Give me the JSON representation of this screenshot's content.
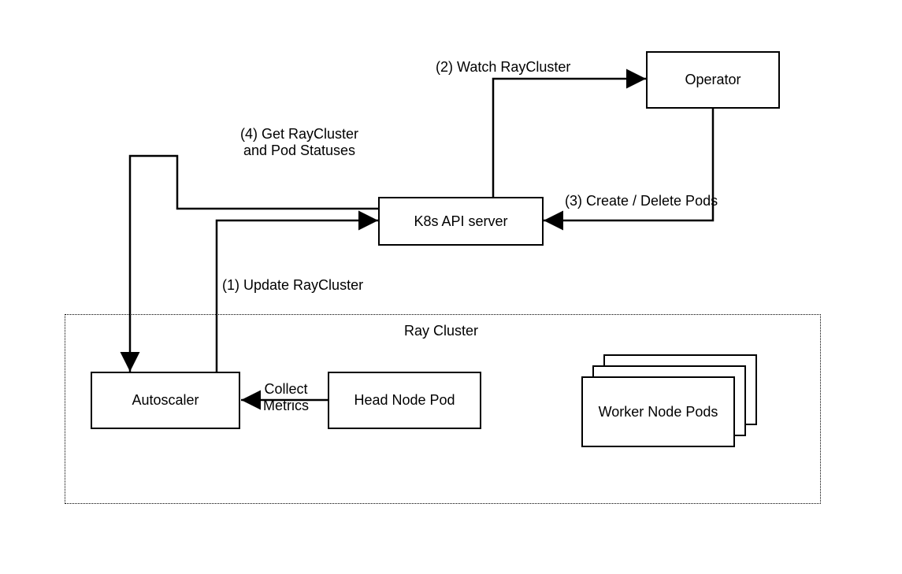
{
  "nodes": {
    "operator": "Operator",
    "k8s_api": "K8s API server",
    "autoscaler": "Autoscaler",
    "head_node": "Head Node Pod",
    "worker_nodes": "Worker Node\nPods"
  },
  "container": {
    "ray_cluster": "Ray Cluster"
  },
  "edges": {
    "update_raycluster": "(1) Update RayCluster",
    "watch_raycluster": "(2) Watch RayCluster",
    "create_delete_pods": "(3) Create / Delete Pods",
    "get_status": "(4) Get RayCluster\nand Pod Statuses",
    "collect_metrics": "Collect\nMetrics"
  }
}
